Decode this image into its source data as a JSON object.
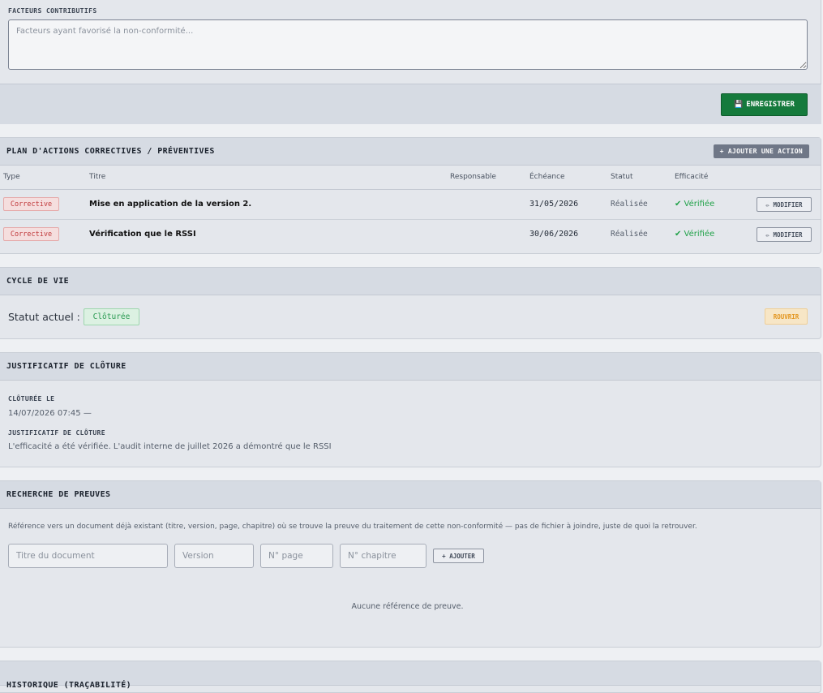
{
  "facteurs": {
    "label": "FACTEURS CONTRIBUTIFS",
    "placeholder": "Facteurs ayant favorisé la non-conformité...",
    "save_icon": "💾",
    "save_label": "ENREGISTRER"
  },
  "plan": {
    "title": "PLAN D'ACTIONS CORRECTIVES / PRÉVENTIVES",
    "add_label": "+ AJOUTER UNE ACTION",
    "columns": [
      "Type",
      "Titre",
      "Responsable",
      "Échéance",
      "Statut",
      "Efficacité"
    ],
    "rows": [
      {
        "type": "Corrective",
        "title": "Mise en application de la version 2.",
        "date": "31/05/2026",
        "status": "Réalisée",
        "eff": "✔ Vérifiée",
        "edit": "✏ MODIFIER"
      },
      {
        "type": "Corrective",
        "title": "Vérification que le RSSI",
        "date": "30/06/2026",
        "status": "Réalisée",
        "eff": "✔ Vérifiée",
        "edit": "✏ MODIFIER"
      }
    ]
  },
  "cycle": {
    "title": "CYCLE DE VIE",
    "status_label": "Statut actuel :",
    "status_value": "Clôturée",
    "reopen_label": "ROUVRIR"
  },
  "justif": {
    "title": "JUSTIFICATIF DE CLÔTURE",
    "closed_label": "CLÔTURÉE LE",
    "closed_value": "14/07/2026 07:45 —",
    "just_label": "JUSTIFICATIF DE CLÔTURE",
    "just_value": "L'efficacité a été vérifiée. L'audit interne de juillet 2026 a démontré que le RSSI"
  },
  "preuves": {
    "title": "RECHERCHE DE PREUVES",
    "description": "Référence vers un document déjà existant (titre, version, page, chapitre) où se trouve la preuve du traitement de cette non-conformité — pas de fichier à joindre, juste de quoi la retrouver.",
    "ph_title": "Titre du document",
    "ph_version": "Version",
    "ph_page": "N° page",
    "ph_chapitre": "N° chapitre",
    "add_label": "+ AJOUTER",
    "empty": "Aucune référence de preuve."
  },
  "histo": {
    "title": "HISTORIQUE (TRAÇABILITÉ)"
  },
  "colors": {
    "save_button": "#157a3c",
    "badge_red": "#c0393b",
    "badge_green": "#2a9a52",
    "reopen": "#e39722",
    "verified": "#22a24a"
  }
}
